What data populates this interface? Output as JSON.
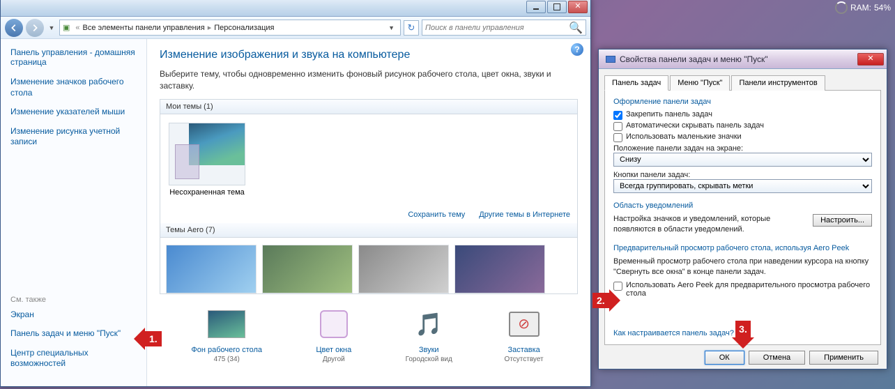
{
  "ram": {
    "label": "RAM:",
    "value": "54%"
  },
  "main": {
    "breadcrumb": {
      "root": "Все элементы панели управления",
      "page": "Персонализация"
    },
    "search_placeholder": "Поиск в панели управления",
    "sidebar": {
      "home": "Панель управления - домашняя страница",
      "links": [
        "Изменение значков рабочего стола",
        "Изменение указателей мыши",
        "Изменение рисунка учетной записи"
      ],
      "see_also": "См. также",
      "see_links": [
        "Экран",
        "Панель задач и меню \"Пуск\"",
        "Центр специальных возможностей"
      ]
    },
    "heading": "Изменение изображения и звука на компьютере",
    "subheading": "Выберите тему, чтобы одновременно изменить фоновый рисунок рабочего стола, цвет окна, звуки и заставку.",
    "mythemes_hdr": "Мои темы (1)",
    "unsaved_theme": "Несохраненная тема",
    "save_theme": "Сохранить тему",
    "more_themes": "Другие темы в Интернете",
    "aero_hdr": "Темы Aero (7)",
    "bottom": {
      "bg": {
        "label": "Фон рабочего стола",
        "sub": "475 (34)"
      },
      "color": {
        "label": "Цвет окна",
        "sub": "Другой"
      },
      "sounds": {
        "label": "Звуки",
        "sub": "Городской вид"
      },
      "saver": {
        "label": "Заставка",
        "sub": "Отсутствует"
      }
    }
  },
  "dialog": {
    "title": "Свойства панели задач и меню \"Пуск\"",
    "tabs": [
      "Панель задач",
      "Меню \"Пуск\"",
      "Панели инструментов"
    ],
    "g1": {
      "hdr": "Оформление панели задач",
      "chk1": "Закрепить панель задач",
      "chk2": "Автоматически скрывать панель задач",
      "chk3": "Использовать маленькие значки",
      "pos_label": "Положение панели задач на экране:",
      "pos_value": "Снизу",
      "btn_label": "Кнопки панели задач:",
      "btn_value": "Всегда группировать, скрывать метки"
    },
    "g2": {
      "hdr": "Область уведомлений",
      "desc": "Настройка значков и уведомлений, которые появляются в области уведомлений.",
      "btn": "Настроить..."
    },
    "g3": {
      "hdr": "Предварительный просмотр рабочего стола, используя Aero Peek",
      "desc": "Временный просмотр рабочего стола при наведении курсора на кнопку \"Свернуть все окна\" в конце панели задач.",
      "chk": "Использовать Aero Peek для предварительного просмотра рабочего стола"
    },
    "link": "Как настраивается панель задач?",
    "ok": "ОК",
    "cancel": "Отмена",
    "apply": "Применить"
  },
  "arrows": {
    "a1": "1.",
    "a2": "2.",
    "a3": "3."
  }
}
